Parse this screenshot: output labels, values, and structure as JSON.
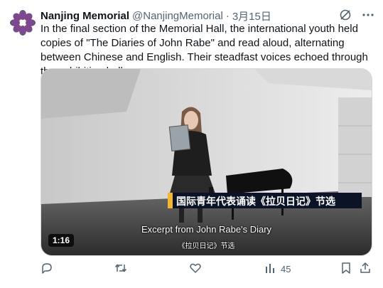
{
  "author": {
    "name": "Nanjing Memorial",
    "handle": "@NanjingMemorial",
    "separator": "·",
    "date": "3月15日"
  },
  "tweet": {
    "text": "In the final section of the Memorial Hall, the international youth held copies of \"The Diaries of John Rabe\" and read aloud, alternating between Chinese and English. Their steadfast voices echoed through the exhibition hall."
  },
  "video": {
    "duration": "1:16",
    "banner_text": "国际青年代表诵读《拉贝日记》节选",
    "subtitle_en": "Excerpt from John Rabe's Diary",
    "subtitle_cn": "《拉贝日记》节选"
  },
  "actions": {
    "views_count": "45"
  },
  "colors": {
    "avatar_purple": "#7b4a8c",
    "banner_bg": "#0b1326",
    "banner_accent": "#f2b632",
    "muted": "#536471"
  },
  "icons": [
    "grok-icon",
    "more-icon",
    "reply-icon",
    "retweet-icon",
    "like-icon",
    "views-icon",
    "bookmark-icon",
    "share-icon"
  ]
}
